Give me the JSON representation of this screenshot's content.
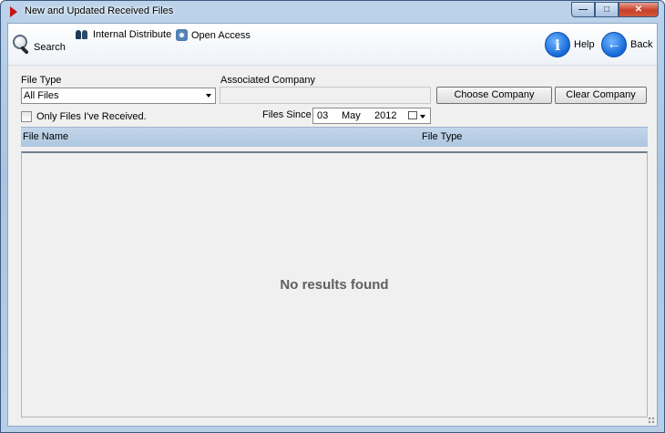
{
  "window": {
    "title": "New and Updated Received Files",
    "controls": {
      "minimize": "—",
      "maximize": "□",
      "close": "✕"
    }
  },
  "toolbar": {
    "search_label": "Search",
    "internal_distribute_label": "Internal Distribute",
    "open_access_label": "Open Access",
    "help_label": "Help",
    "back_label": "Back",
    "help_glyph": "i",
    "back_glyph": "←"
  },
  "filters": {
    "file_type_label": "File Type",
    "file_type_value": "All Files",
    "associated_company_label": "Associated Company",
    "associated_company_value": "",
    "choose_company_label": "Choose Company",
    "clear_company_label": "Clear Company",
    "only_received_label": "Only Files I've Received.",
    "only_received_checked": false,
    "files_since_label": "Files Since",
    "date": {
      "day": "03",
      "month": "May",
      "year": "2012"
    }
  },
  "grid": {
    "columns": [
      "File Name",
      "File Type"
    ],
    "rows": [],
    "empty_message": "No results found"
  }
}
